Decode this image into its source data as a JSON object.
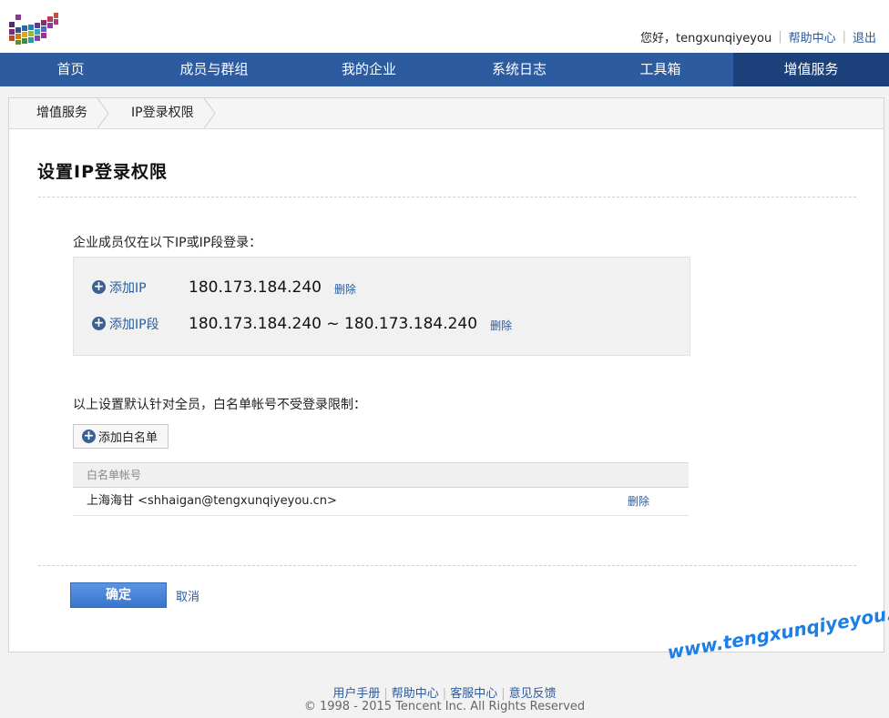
{
  "header": {
    "greeting": "您好，tengxunqiyeyou",
    "help_link": "帮助中心",
    "logout_link": "退出"
  },
  "nav": {
    "items": [
      "首页",
      "成员与群组",
      "我的企业",
      "系统日志",
      "工具箱",
      "增值服务"
    ],
    "active_index": 5
  },
  "breadcrumb": {
    "items": [
      "增值服务",
      "IP登录权限"
    ]
  },
  "page": {
    "title": "设置IP登录权限",
    "ip_section_label": "企业成员仅在以下IP或IP段登录：",
    "add_ip_label": "添加IP",
    "ip_value": "180.173.184.240",
    "add_ip_range_label": "添加IP段",
    "ip_range_value": "180.173.184.240 ~ 180.173.184.240",
    "delete_label": "删除",
    "whitelist_label": "以上设置默认针对全员，白名单帐号不受登录限制：",
    "add_whitelist_button": "添加白名单",
    "whitelist_table": {
      "header": "白名单帐号",
      "rows": [
        {
          "account": "上海海甘 <shhaigan@tengxunqiyeyou.cn>",
          "action": "删除"
        }
      ]
    },
    "confirm_button": "确定",
    "cancel_link": "取消"
  },
  "footer": {
    "links": [
      "用户手册",
      "帮助中心",
      "客服中心",
      "意见反馈"
    ],
    "copyright": "© 1998 - 2015 Tencent Inc. All Rights Reserved"
  },
  "watermark": "www.tengxunqiyeyou.com",
  "colors": {
    "nav_bg": "#2c5b9f",
    "nav_active_bg": "#1c417a",
    "link": "#2a5a9c",
    "primary_button": "#3a75ce"
  }
}
